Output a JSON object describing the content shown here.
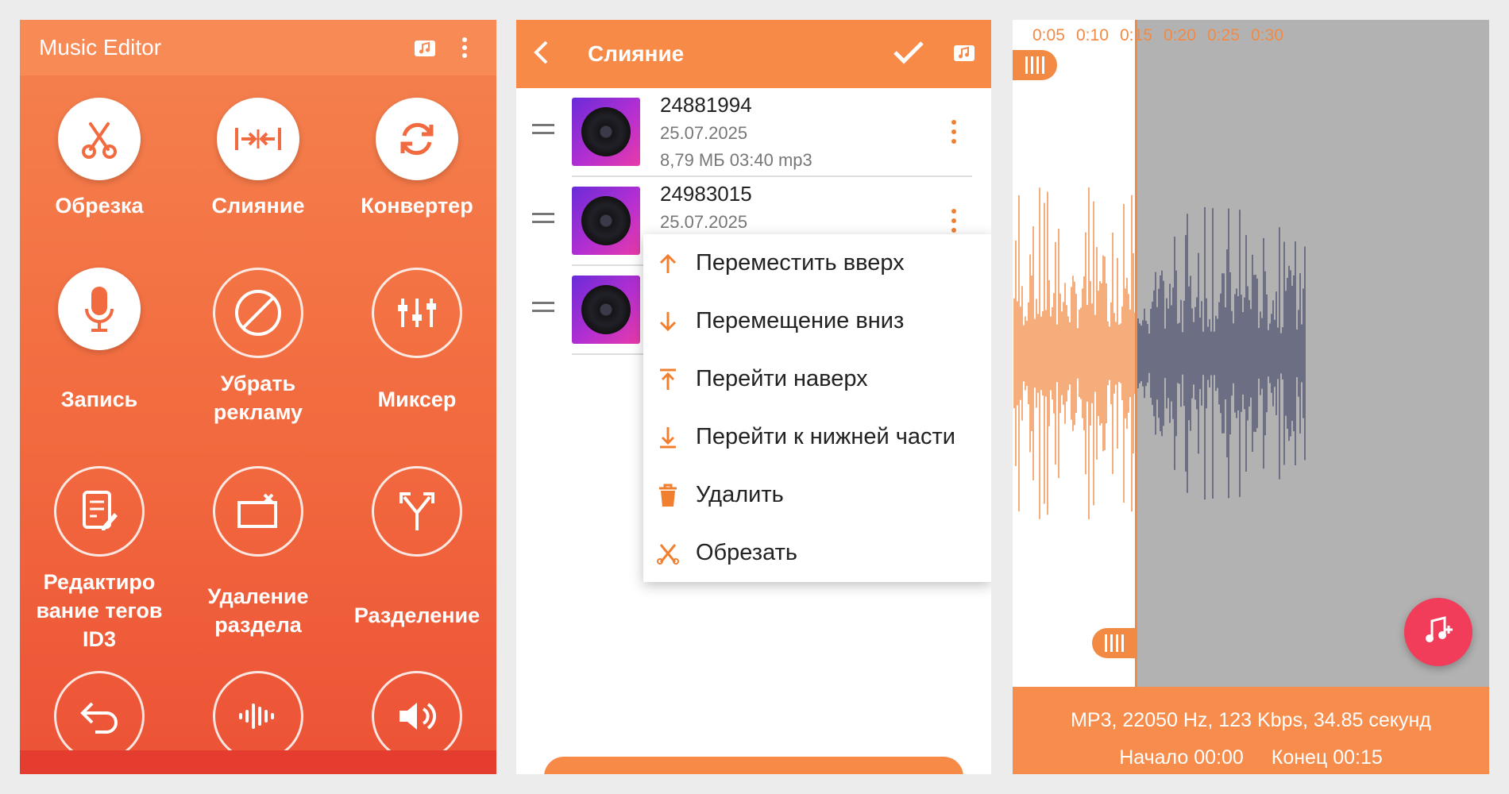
{
  "home": {
    "app_title": "Music Editor",
    "tiles": [
      {
        "label": "Обрезка",
        "icon": "scissors-icon"
      },
      {
        "label": "Слияние",
        "icon": "merge-icon"
      },
      {
        "label": "Конвертер",
        "icon": "refresh-icon"
      },
      {
        "label": "Запись",
        "icon": "microphone-icon"
      },
      {
        "label": "Убрать рекламу",
        "icon": "no-ads-icon"
      },
      {
        "label": "Миксер",
        "icon": "sliders-icon"
      },
      {
        "label": "Редактиро вание тегов ID3",
        "icon": "tag-edit-icon"
      },
      {
        "label": "Удаление раздела",
        "icon": "remove-section-icon"
      },
      {
        "label": "Разделение",
        "icon": "split-icon"
      },
      {
        "label": "",
        "icon": "undo-icon"
      },
      {
        "label": "",
        "icon": "audio-wave-icon"
      },
      {
        "label": "",
        "icon": "volume-icon"
      }
    ]
  },
  "merge": {
    "title": "Слияние",
    "tracks": [
      {
        "name": "24881994",
        "date": "25.07.2025",
        "meta": "8,79 МБ  03:40  mp3"
      },
      {
        "name": "24983015",
        "date": "25.07.2025",
        "meta": ""
      },
      {
        "name": "",
        "date": "",
        "meta": ""
      }
    ],
    "menu": [
      {
        "label": "Переместить вверх",
        "icon": "arrow-up-icon"
      },
      {
        "label": "Перемещение вниз",
        "icon": "arrow-down-icon"
      },
      {
        "label": "Перейти наверх",
        "icon": "to-top-icon"
      },
      {
        "label": "Перейти к нижней части",
        "icon": "to-bottom-icon"
      },
      {
        "label": "Удалить",
        "icon": "trash-icon"
      },
      {
        "label": "Обрезать",
        "icon": "cut-icon"
      }
    ]
  },
  "trim": {
    "timeline_ticks": [
      "0:05",
      "0:10",
      "0:15",
      "0:20",
      "0:25",
      "0:30"
    ],
    "info": "MP3, 22050 Hz, 123 Kbps, 34.85 секунд",
    "start": "Начало 00:00",
    "end": "Конец 00:15"
  },
  "colors": {
    "accent": "#f78a46",
    "red_accent": "#f23d5a",
    "wave_selected": "#f28a44",
    "wave_unselected": "#4f5270"
  }
}
